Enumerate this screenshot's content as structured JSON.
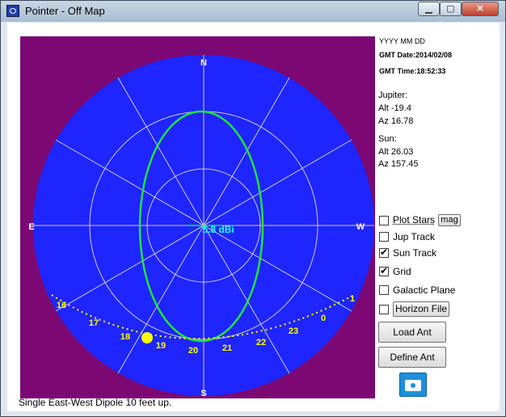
{
  "window": {
    "title": "Pointer - Off Map"
  },
  "plot": {
    "compass": {
      "north": "N",
      "south": "S",
      "east": "E",
      "west": "W"
    },
    "center_gain": "5.8 dBi",
    "hour_labels": [
      "16",
      "17",
      "18",
      "19",
      "20",
      "21",
      "22",
      "23",
      "0",
      "1"
    ],
    "colors": {
      "sky": "#1f25ff",
      "background": "#7b0873",
      "pattern": "#22e33c",
      "track": "#ffff00",
      "grid": "#c8c8f0",
      "gain_text": "#22ffff"
    }
  },
  "info": {
    "date_format": "YYYY MM DD",
    "gmt_date": "GMT Date:2014/02/08",
    "gmt_time": "GMT Time:18:52:33",
    "jupiter": {
      "label": "Jupiter:",
      "alt": "Alt -19.4",
      "az": "Az 16.78"
    },
    "sun": {
      "label": "Sun:",
      "alt": "Alt 26.03",
      "az": "Az 157.45"
    }
  },
  "controls": {
    "plot_stars": {
      "label": "Plot Stars",
      "checked": ""
    },
    "mag_button": "mag",
    "jup_track": {
      "label": "Jup Track",
      "checked": ""
    },
    "sun_track": {
      "label": "Sun Track",
      "checked": "✔"
    },
    "grid": {
      "label": "Grid",
      "checked": "✔"
    },
    "galactic_plane": {
      "label": "Galactic Plane",
      "checked": ""
    },
    "horizon_file": {
      "label": "Horizon File",
      "checked": ""
    },
    "load_ant": "Load Ant",
    "define_ant": "Define Ant",
    "camera_icon": "camera-icon"
  },
  "status": {
    "text": "Single East-West Dipole 10 feet up."
  }
}
